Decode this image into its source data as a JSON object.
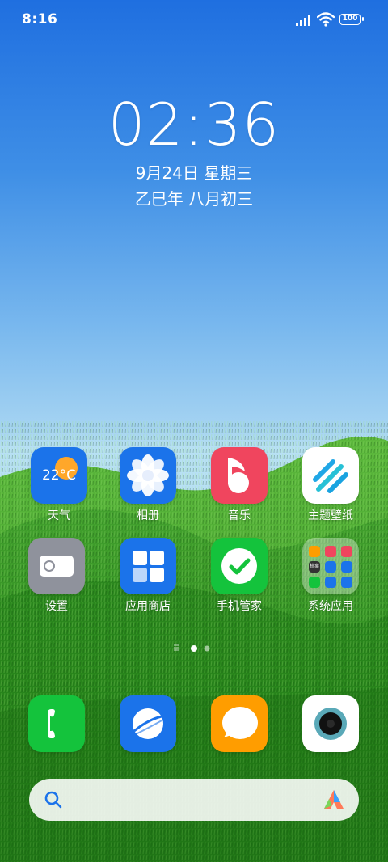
{
  "status_bar": {
    "time": "8:16",
    "battery": "100"
  },
  "lockclock": {
    "time": "02:36",
    "date": "9月24日 星期三",
    "lunar": "乙巳年 八月初三"
  },
  "apps_row1": [
    {
      "label": "天气",
      "icon": "weather-icon",
      "temp": "22°C"
    },
    {
      "label": "相册",
      "icon": "gallery-icon"
    },
    {
      "label": "音乐",
      "icon": "music-icon"
    },
    {
      "label": "主题壁纸",
      "icon": "themes-icon"
    }
  ],
  "apps_row2": [
    {
      "label": "设置",
      "icon": "settings-icon"
    },
    {
      "label": "应用商店",
      "icon": "app-store-icon"
    },
    {
      "label": "手机管家",
      "icon": "security-icon"
    },
    {
      "label": "系统应用",
      "icon": "folder-icon"
    }
  ],
  "folder_mini": [
    "档案"
  ],
  "dock": [
    {
      "icon": "phone-icon"
    },
    {
      "icon": "browser-icon"
    },
    {
      "icon": "messages-icon"
    },
    {
      "icon": "camera-icon"
    }
  ],
  "page_indicator": {
    "pages": 2,
    "current": 1
  },
  "colors": {
    "green": "#14c33c",
    "blue": "#1b73ea",
    "red": "#f0455e",
    "orange": "#ff9d00"
  }
}
